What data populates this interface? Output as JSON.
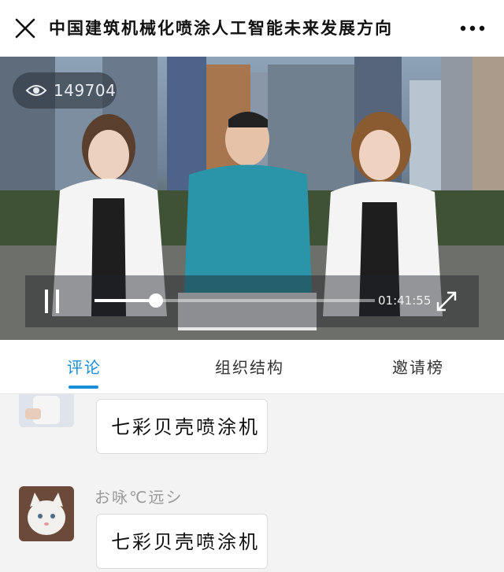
{
  "header": {
    "title": "中国建筑机械化喷涂人工智能未来发展方向",
    "close_icon": "close-icon",
    "more_icon": "more-icon"
  },
  "video": {
    "view_count": "149704",
    "view_icon": "eye-icon",
    "time": "01:41:55",
    "progress": 0.22,
    "play_icon": "pause-icon",
    "fullscreen_icon": "fullscreen-icon"
  },
  "tabs": [
    {
      "label": "评论",
      "active": true
    },
    {
      "label": "组织结构",
      "active": false
    },
    {
      "label": "邀请榜",
      "active": false
    }
  ],
  "comments": [
    {
      "username": "",
      "text": "七彩贝壳喷涂机"
    },
    {
      "username": "お咏℃远シ",
      "text": "七彩贝壳喷涂机"
    }
  ],
  "colors": {
    "accent": "#1a8ed6",
    "background": "#f3f3f3"
  }
}
